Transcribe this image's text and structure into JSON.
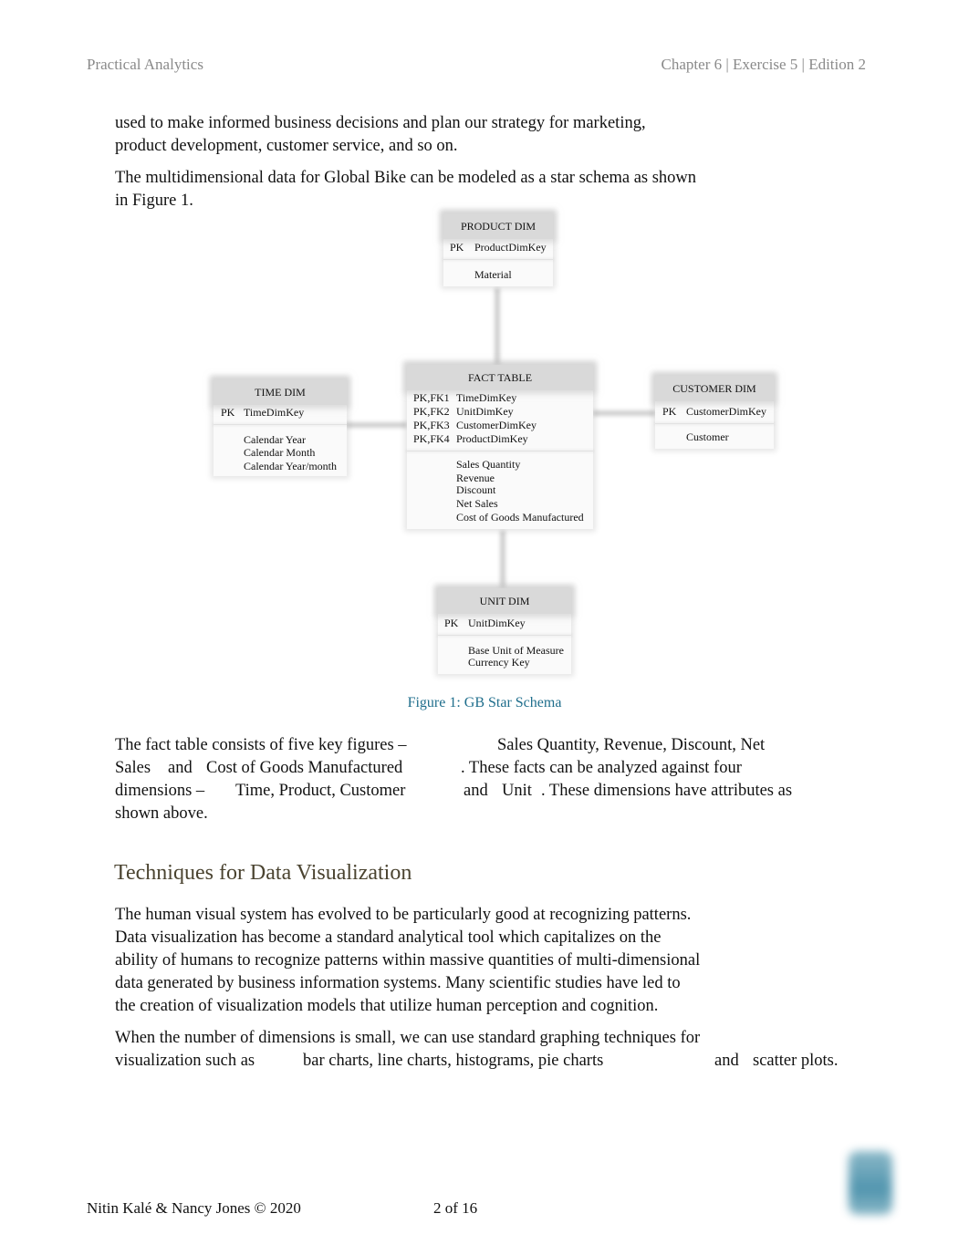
{
  "header": {
    "left": "Practical Analytics",
    "right": "Chapter 6 | Exercise 5 | Edition 2"
  },
  "intro": {
    "p1_line1": "used to make informed business decisions and plan our strategy for marketing,",
    "p1_line2": "product development, customer service, and so on.",
    "p2_line1": "The multidimensional data for Global Bike can be modeled as a star schema as shown",
    "p2_line2": "in Figure 1."
  },
  "diagram": {
    "product_dim": {
      "title": "PRODUCT DIM",
      "pk_label": "PK",
      "key": "ProductDimKey",
      "attributes": [
        "Material"
      ]
    },
    "time_dim": {
      "title": "TIME DIM",
      "pk_label": "PK",
      "key": "TimeDimKey",
      "attributes": [
        "Calendar Year",
        "Calendar Month",
        "Calendar Year/month"
      ]
    },
    "fact_table": {
      "title": "FACT TABLE",
      "keys": [
        {
          "label": "PK,FK1",
          "name": "TimeDimKey"
        },
        {
          "label": "PK,FK2",
          "name": "UnitDimKey"
        },
        {
          "label": "PK,FK3",
          "name": "CustomerDimKey"
        },
        {
          "label": "PK,FK4",
          "name": "ProductDimKey"
        }
      ],
      "measures": [
        "Sales Quantity",
        "Revenue",
        "Discount",
        "Net Sales",
        "Cost of Goods Manufactured"
      ]
    },
    "customer_dim": {
      "title": "CUSTOMER DIM",
      "pk_label": "PK",
      "key": "CustomerDimKey",
      "attributes": [
        "Customer"
      ]
    },
    "unit_dim": {
      "title": "UNIT DIM",
      "pk_label": "PK",
      "key": "UnitDimKey",
      "attributes": [
        "Base Unit of Measure",
        "Currency Key"
      ]
    },
    "caption": "Figure 1: GB Star Schema"
  },
  "facts_para": {
    "l1a": "The fact table consists of five key figures –",
    "l1b": "Sales Quantity, Revenue, Discount, Net",
    "l2a": "Sales",
    "l2b": "and",
    "l2c": "Cost of Goods Manufactured",
    "l2d": ". These facts can be analyzed against four",
    "l3a": "dimensions –",
    "l3b": "Time, Product, Customer",
    "l3c": "and",
    "l3d": "Unit",
    "l3e": ". These dimensions have attributes as",
    "l4": "shown above."
  },
  "section": {
    "heading": "Techniques for Data Visualization",
    "p1": [
      "The human visual system has evolved to be particularly good at recognizing patterns.",
      "Data visualization has become a standard analytical tool which capitalizes on the",
      "ability of humans to recognize patterns within massive quantities of multi-dimensional",
      "data generated by business information systems. Many scientific studies have led to",
      "the creation of visualization models that utilize human perception and cognition."
    ],
    "p2_line1": "When the number of dimensions is small, we can use standard graphing techniques for",
    "p2_l2a": "visualization such as",
    "p2_l2b": "bar charts, line charts, histograms, pie charts",
    "p2_l2c": "and",
    "p2_l2d": "scatter plots."
  },
  "footer": {
    "authors": "Nitin Kalé & Nancy Jones © 2020",
    "page": "2 of 16"
  }
}
